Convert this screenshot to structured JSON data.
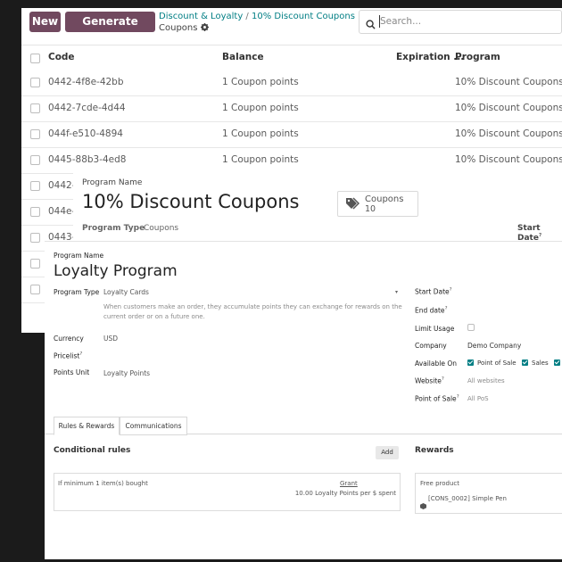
{
  "list": {
    "new_label": "New",
    "generate_label": "Generate Coupons",
    "breadcrumb": [
      "Discount & Loyalty",
      "/",
      "10% Discount Coupons"
    ],
    "subtitle": "Coupons",
    "search_placeholder": "Search...",
    "columns": [
      "Code",
      "Balance",
      "Expiration ...",
      "Program"
    ],
    "rows": [
      {
        "code": "0442-4f8e-42bb",
        "balance": "1 Coupon points",
        "program": "10% Discount Coupons"
      },
      {
        "code": "0442-7cde-4d44",
        "balance": "1 Coupon points",
        "program": "10% Discount Coupons"
      },
      {
        "code": "044f-e510-4894",
        "balance": "1 Coupon points",
        "program": "10% Discount Coupons"
      },
      {
        "code": "0445-88b3-4ed8",
        "balance": "1 Coupon points",
        "program": "10% Discount Coupons"
      },
      {
        "code": "0442-"
      },
      {
        "code": "044e-"
      },
      {
        "code": "0443-"
      },
      {
        "code": ""
      },
      {
        "code": ""
      }
    ]
  },
  "discount": {
    "program_name_label": "Program Name",
    "program_name": "10% Discount Coupons",
    "coupons_label": "Coupons",
    "coupons_count": "10",
    "program_type_label": "Program Type",
    "program_type_value": "Coupons",
    "start_date_label": "Start Date"
  },
  "loyalty": {
    "program_name_label": "Program Name",
    "program_name": "Loyalty Program",
    "program_type_label": "Program Type",
    "program_type_value": "Loyalty Cards",
    "program_type_help": [
      "When customers make an order, they accumulate points they can exchange for rewards on the",
      "current order or on a future one."
    ],
    "currency_label": "Currency",
    "currency_value": "USD",
    "pricelist_label": "Pricelist",
    "points_unit_label": "Points Unit",
    "points_unit_value": "Loyalty Points",
    "start_date_label": "Start Date",
    "end_date_label": "End date",
    "limit_usage_label": "Limit Usage",
    "company_label": "Company",
    "company_value": "Demo Company",
    "available_on_label": "Available On",
    "available_on": [
      "Point of Sale",
      "Sales"
    ],
    "website_label": "Website",
    "website_value": "All websites",
    "pos_label": "Point of Sale",
    "pos_value": "All PoS",
    "tabs": [
      "Rules & Rewards",
      "Communications"
    ],
    "conditional_rules_title": "Conditional rules",
    "add_label": "Add",
    "rule_condition": "If minimum 1 item(s) bought",
    "rule_grant_label": "Grant",
    "rule_grant_value": "10.00 Loyalty Points per $ spent",
    "rewards_title": "Rewards",
    "reward_type": "Free product",
    "reward_product": "[CONS_0002] Simple Pen"
  },
  "colors": {
    "primary": "#71495f",
    "teal": "#017e84",
    "backdrop": "#1b1b1b"
  }
}
